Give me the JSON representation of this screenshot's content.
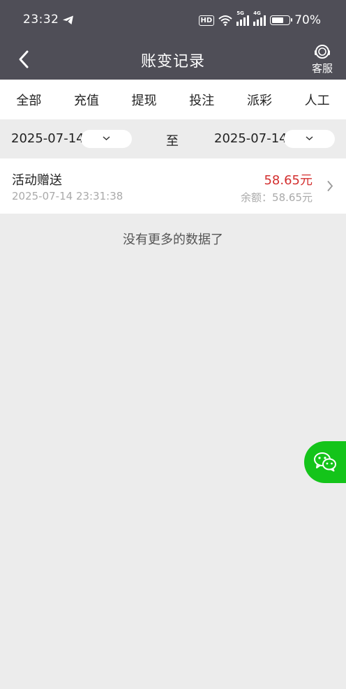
{
  "status_bar": {
    "time": "23:32",
    "hd_badge": "HD",
    "signal1_label": "5G",
    "signal2_label": "4G",
    "battery_percent": "70%",
    "battery_level": 0.7
  },
  "header": {
    "title": "账变记录",
    "customer_service_label": "客服"
  },
  "tabs": [
    {
      "label": "全部"
    },
    {
      "label": "充值"
    },
    {
      "label": "提现"
    },
    {
      "label": "投注"
    },
    {
      "label": "派彩"
    },
    {
      "label": "人工"
    }
  ],
  "date_filter": {
    "start_date": "2025-07-14",
    "separator": "至",
    "end_date": "2025-07-14"
  },
  "records": [
    {
      "name": "活动赠送",
      "time": "2025-07-14 23:31:38",
      "amount": "58.65元",
      "balance": "余额：58.65元"
    }
  ],
  "empty_message": "没有更多的数据了",
  "colors": {
    "header_bg": "#4f4e57",
    "amount": "#d32f2f",
    "wechat": "#14c41a",
    "page_bg": "#ececec"
  }
}
